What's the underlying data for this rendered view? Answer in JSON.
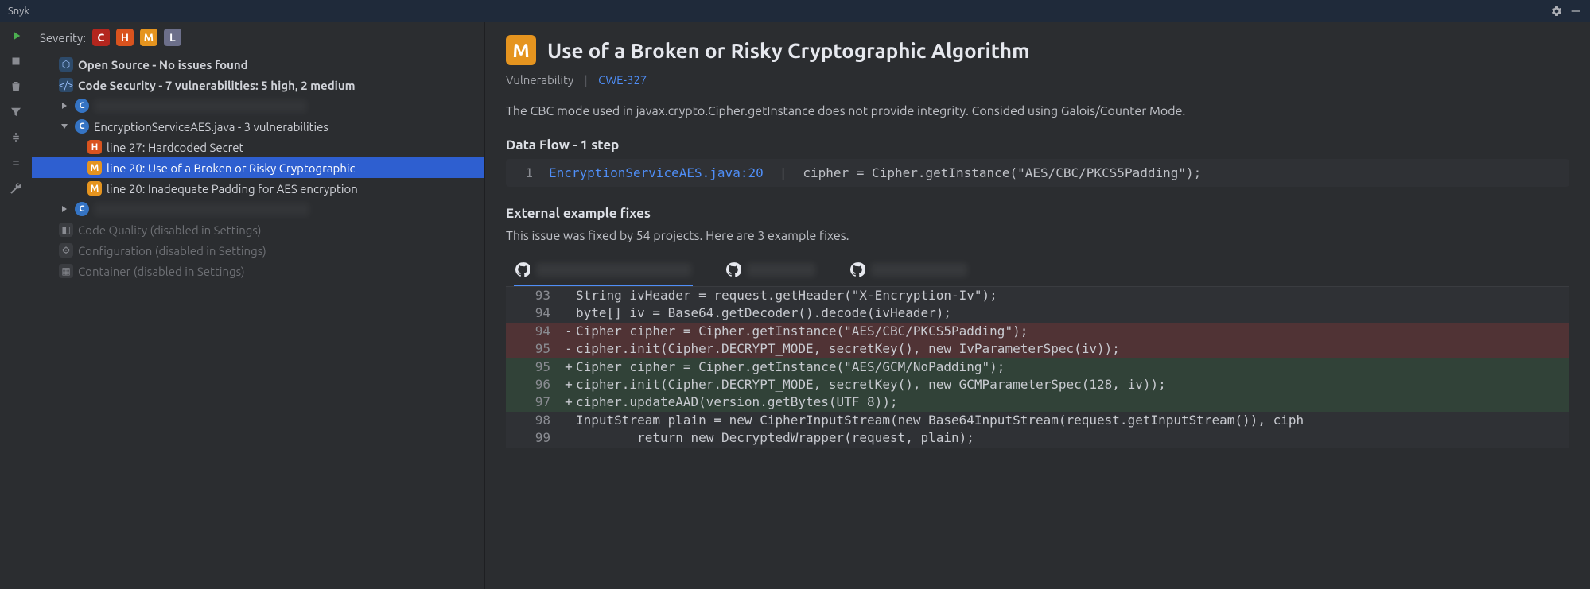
{
  "titlebar": {
    "title": "Snyk"
  },
  "severity": {
    "label": "Severity:",
    "items": [
      "C",
      "H",
      "M",
      "L"
    ]
  },
  "tree": {
    "open_source": {
      "label": "Open Source - No issues found"
    },
    "code_security": {
      "label": "Code Security - 7 vulnerabilities: 5 high, 2 medium"
    },
    "file1_blur": "xxxxxxxxxxx xxxxxx xxxx   x xxxxxxxxxx",
    "file2": {
      "label": "EncryptionServiceAES.java - 3 vulnerabilities"
    },
    "vulnA": {
      "badge": "H",
      "label": "line 27: Hardcoded Secret"
    },
    "vulnB": {
      "badge": "M",
      "label": "line 20: Use of a Broken or Risky Cryptographic"
    },
    "vulnC": {
      "badge": "M",
      "label": "line 20: Inadequate Padding for AES encryption"
    },
    "file3_blur": "xxxxxxxxxxxxxxxxxxxxxxxxxxxxxxxxxx",
    "code_quality": {
      "label": "Code Quality (disabled in Settings)"
    },
    "configuration": {
      "label": "Configuration (disabled in Settings)"
    },
    "container": {
      "label": "Container (disabled in Settings)"
    }
  },
  "detail": {
    "badge": "M",
    "title": "Use of a Broken or Risky Cryptographic Algorithm",
    "type": "Vulnerability",
    "cwe": "CWE-327",
    "description": "The CBC mode used in javax.crypto.Cipher.getInstance does not provide integrity. Consided using Galois/Counter Mode.",
    "dataflow_heading": "Data Flow - 1 step",
    "flow_line_no": "1",
    "flow_file": "EncryptionServiceAES.java:20",
    "flow_sep": "|",
    "flow_code": "cipher = Cipher.getInstance(\"AES/CBC/PKCS5Padding\");",
    "examples_heading": "External example fixes",
    "examples_sub": "This issue was fixed by 54 projects. Here are 3 example fixes.",
    "tabs": [
      {
        "blur": "xxxxxxxx xxxxxxxxxxx xxxx"
      },
      {
        "blur": "xxxxxxxxxx"
      },
      {
        "blur": "xxxxxxxxx xxxxx"
      }
    ],
    "diff": [
      {
        "ln": "93",
        "sign": " ",
        "kind": "ctx",
        "code": "String ivHeader = request.getHeader(\"X-Encryption-Iv\");"
      },
      {
        "ln": "94",
        "sign": " ",
        "kind": "ctx",
        "code": "byte[] iv = Base64.getDecoder().decode(ivHeader);"
      },
      {
        "ln": "94",
        "sign": "-",
        "kind": "del",
        "code": "Cipher cipher = Cipher.getInstance(\"AES/CBC/PKCS5Padding\");"
      },
      {
        "ln": "95",
        "sign": "-",
        "kind": "del",
        "code": "cipher.init(Cipher.DECRYPT_MODE, secretKey(), new IvParameterSpec(iv));"
      },
      {
        "ln": "95",
        "sign": "+",
        "kind": "add",
        "code": "Cipher cipher = Cipher.getInstance(\"AES/GCM/NoPadding\");"
      },
      {
        "ln": "96",
        "sign": "+",
        "kind": "add",
        "code": "cipher.init(Cipher.DECRYPT_MODE, secretKey(), new GCMParameterSpec(128, iv));"
      },
      {
        "ln": "97",
        "sign": "+",
        "kind": "add",
        "code": "cipher.updateAAD(version.getBytes(UTF_8));"
      },
      {
        "ln": "98",
        "sign": " ",
        "kind": "ctx",
        "code": "InputStream plain = new CipherInputStream(new Base64InputStream(request.getInputStream()), ciph"
      },
      {
        "ln": "99",
        "sign": " ",
        "kind": "ctx",
        "code": "        return new DecryptedWrapper(request, plain);"
      }
    ]
  }
}
